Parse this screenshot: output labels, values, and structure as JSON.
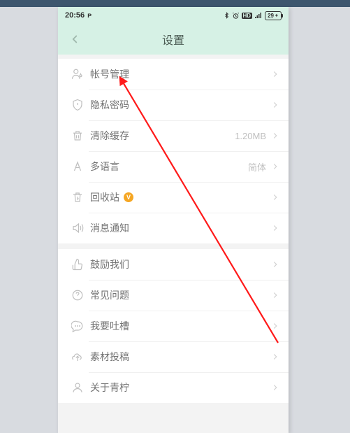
{
  "status": {
    "time": "20:56",
    "battery": "29"
  },
  "nav": {
    "title": "设置"
  },
  "groups": [
    {
      "rows": [
        {
          "icon": "user-icon",
          "label": "帐号管理",
          "value": ""
        },
        {
          "icon": "shield-icon",
          "label": "隐私密码",
          "value": ""
        },
        {
          "icon": "trash-icon",
          "label": "清除缓存",
          "value": "1.20MB"
        },
        {
          "icon": "font-icon",
          "label": "多语言",
          "value": "简体"
        },
        {
          "icon": "recycle-icon",
          "label": "回收站",
          "value": "",
          "badge": "V"
        },
        {
          "icon": "sound-icon",
          "label": "消息通知",
          "value": ""
        }
      ]
    },
    {
      "rows": [
        {
          "icon": "thumb-icon",
          "label": "鼓励我们",
          "value": ""
        },
        {
          "icon": "help-icon",
          "label": "常见问题",
          "value": ""
        },
        {
          "icon": "chat-icon",
          "label": "我要吐槽",
          "value": ""
        },
        {
          "icon": "upload-icon",
          "label": "素材投稿",
          "value": ""
        },
        {
          "icon": "about-icon",
          "label": "关于青柠",
          "value": ""
        }
      ]
    }
  ]
}
